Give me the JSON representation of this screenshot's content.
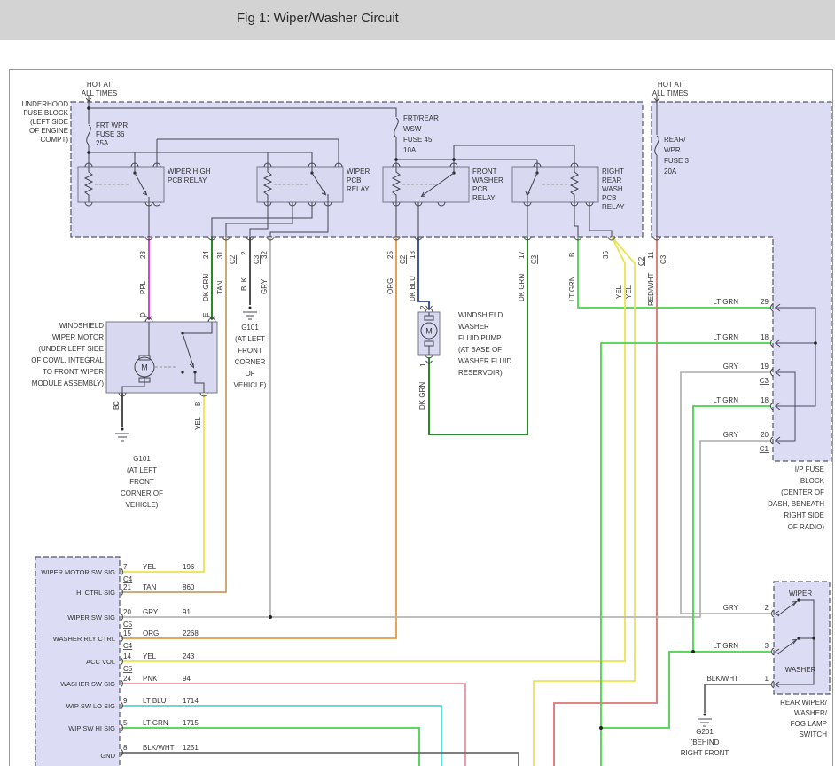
{
  "title": "Fig 1: Wiper/Washer Circuit",
  "hot_left": [
    "HOT AT",
    "ALL TIMES"
  ],
  "hot_right": [
    "HOT AT",
    "ALL TIMES"
  ],
  "underhood_label": [
    "UNDERHOOD",
    "FUSE BLOCK",
    "(LEFT SIDE",
    "OF ENGINE",
    "COMPT)"
  ],
  "fuse36": [
    "FRT WPR",
    "FUSE 36",
    "25A"
  ],
  "fuse45": [
    "FRT/REAR",
    "WSW",
    "FUSE 45",
    "10A"
  ],
  "fuse3": [
    "REAR/",
    "WPR",
    "FUSE 3",
    "20A"
  ],
  "relay1": [
    "WIPER HIGH",
    "PCB RELAY"
  ],
  "relay2": [
    "WIPER",
    "PCB",
    "RELAY"
  ],
  "relay3": [
    "FRONT",
    "WASHER",
    "PCB",
    "RELAY"
  ],
  "relay4": [
    "RIGHT",
    "REAR",
    "WASH",
    "PCB",
    "RELAY"
  ],
  "motor_label": [
    "WINDSHIELD",
    "WIPER MOTOR",
    "(UNDER LEFT SIDE",
    "OF COWL, INTEGRAL",
    "TO FRONT WIPER",
    "MODULE ASSEMBLY)"
  ],
  "motor_sym": "M",
  "motor_pins": [
    "D",
    "E",
    "C",
    "B"
  ],
  "pump_label": [
    "WINDSHIELD",
    "WASHER",
    "FLUID PUMP",
    "(AT BASE OF",
    "WASHER FLUID",
    "RESERVOIR)"
  ],
  "pump_sym": "M",
  "pump_pins": [
    "2",
    "1"
  ],
  "pump_wire_color": "DK GRN",
  "g101_motor": [
    "G101",
    "(AT LEFT",
    "FRONT",
    "CORNER OF",
    "VEHICLE)"
  ],
  "g101_relay": [
    "G101",
    "(AT LEFT",
    "FRONT",
    "CORNER",
    "OF",
    "VEHICLE)"
  ],
  "g201": [
    "G201",
    "(BEHIND",
    "RIGHT FRONT"
  ],
  "ip_label": [
    "I/P FUSE",
    "BLOCK",
    "(CENTER OF",
    "DASH, BENEATH",
    "RIGHT SIDE",
    "OF RADIO)"
  ],
  "switch_label": [
    "REAR WIPER/",
    "WASHER/",
    "FOG LAMP",
    "SWITCH"
  ],
  "switch": {
    "wiper": "WIPER",
    "washer": "WASHER",
    "pins": [
      {
        "color": "GRY",
        "pin": "2"
      },
      {
        "color": "LT GRN",
        "pin": "3"
      },
      {
        "color": "BLK/WHT",
        "pin": "1"
      }
    ]
  },
  "top_pins": [
    {
      "pin": "23",
      "color": "PPL"
    },
    {
      "pin": "24",
      "color": "DK GRN"
    },
    {
      "pin": "31",
      "conn": "C2",
      "color": "TAN"
    },
    {
      "pin": "2",
      "conn": "C3",
      "color": "BLK"
    },
    {
      "pin": "32",
      "color": "GRY"
    },
    {
      "pin": "25",
      "conn": "C2",
      "color": "ORG"
    },
    {
      "pin": "18",
      "color": "DK BLU"
    },
    {
      "pin": "17",
      "conn": "C3",
      "color": "DK GRN"
    },
    {
      "pin": "B",
      "color": "LT GRN"
    },
    {
      "pin": "36",
      "conn": "C2",
      "color": "YEL",
      "color2": "YEL"
    },
    {
      "pin": "11",
      "conn": "C3",
      "color": "RED/WHT"
    }
  ],
  "ip_pins": [
    {
      "color": "LT GRN",
      "pin": "29"
    },
    {
      "color": "LT GRN",
      "pin": "18"
    },
    {
      "color": "GRY",
      "pin": "19",
      "conn": "C3"
    },
    {
      "color": "LT GRN",
      "pin": "18"
    },
    {
      "color": "GRY",
      "pin": "20",
      "conn": "C1"
    }
  ],
  "bcm_rows": [
    {
      "name": "WIPER MOTOR SW SIG",
      "pin": "7",
      "color": "YEL",
      "circuit": "196",
      "conn": "C4"
    },
    {
      "name": "HI CTRL SIG",
      "pin": "21",
      "color": "TAN",
      "circuit": "860"
    },
    {
      "name": "WIPER SW SIG",
      "pin": "20",
      "color": "GRY",
      "circuit": "91",
      "conn": "C5"
    },
    {
      "name": "WASHER RLY CTRL",
      "pin": "15",
      "color": "ORG",
      "circuit": "2268",
      "conn": "C4"
    },
    {
      "name": "ACC VOL",
      "pin": "14",
      "color": "YEL",
      "circuit": "243",
      "conn": "C5"
    },
    {
      "name": "WASHER SW SIG",
      "pin": "24",
      "color": "PNK",
      "circuit": "94"
    },
    {
      "name": "WIP SW LO SIG",
      "pin": "9",
      "color": "LT BLU",
      "circuit": "1714"
    },
    {
      "name": "WIP SW HI SIG",
      "pin": "5",
      "color": "LT GRN",
      "circuit": "1715"
    },
    {
      "name": "GND",
      "pin": "8",
      "color": "BLK/WHT",
      "circuit": "1251"
    }
  ],
  "wire_colors": {
    "PPL": "#cc33cc",
    "DK GRN": "#0f7d0f",
    "TAN": "#c7a066",
    "BLK": "#3c3c3c",
    "GRY": "#b6b6b6",
    "ORG": "#e29a44",
    "DK BLU": "#2f4596",
    "LT GRN": "#4ad34a",
    "YEL": "#ebe34e",
    "RED/WHT": "#d97575",
    "PNK": "#ee8f9f",
    "LT BLU": "#49d8d8",
    "BLK/WHT": "#6e6e6e"
  }
}
